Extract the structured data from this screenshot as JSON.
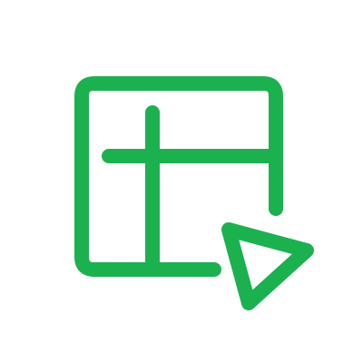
{
  "icon": {
    "name": "spreadsheet-play-icon",
    "color": "#1cb14f",
    "background": "#ffffff"
  }
}
